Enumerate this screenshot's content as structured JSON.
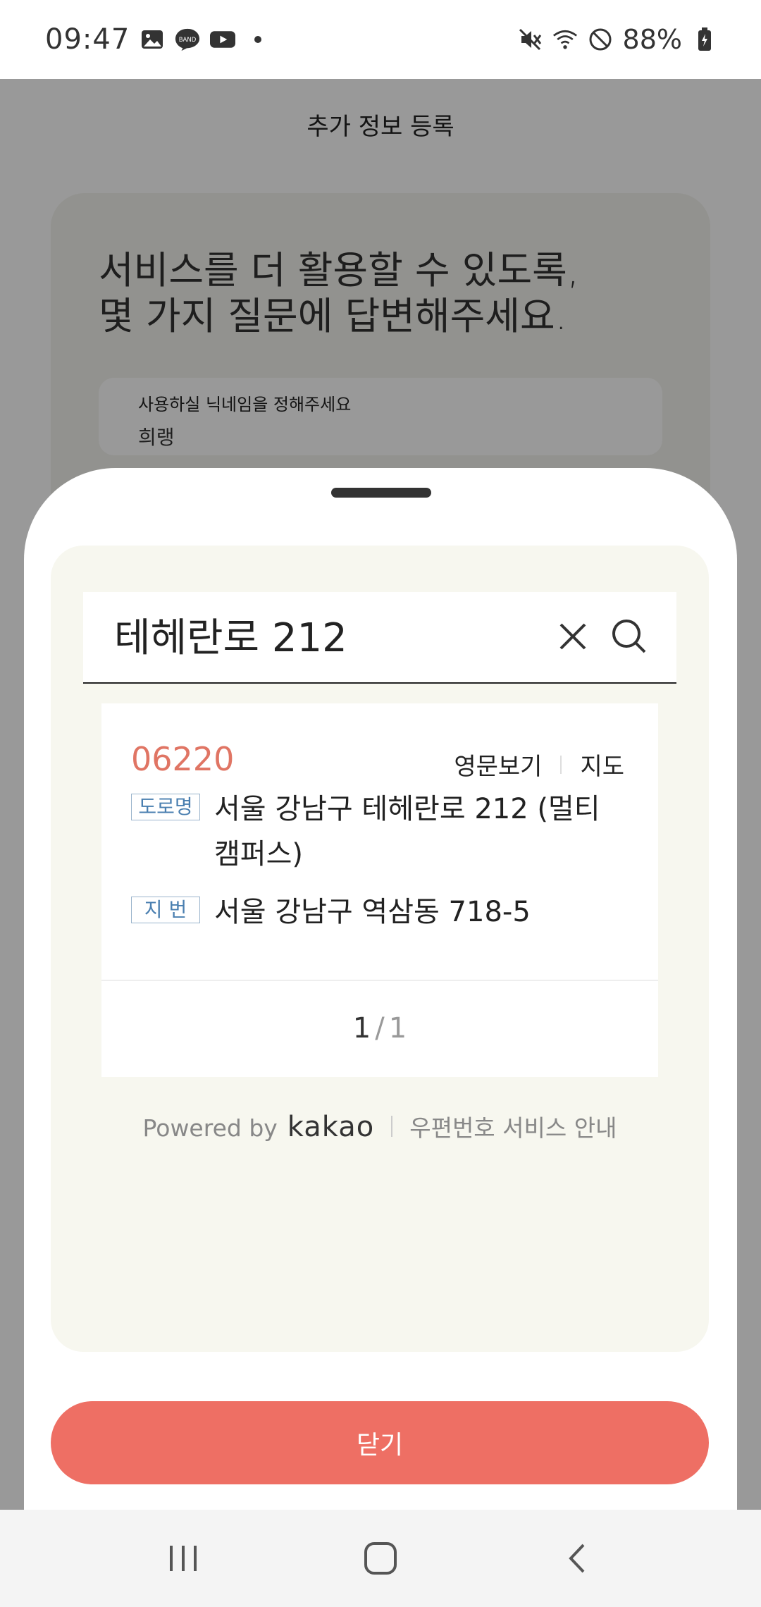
{
  "status_bar": {
    "time": "09:47",
    "battery_pct": "88%",
    "notification_icons": [
      "gallery-icon",
      "band-icon",
      "youtube-icon",
      "dot-icon"
    ],
    "system_icons": [
      "mute-icon",
      "wifi-icon",
      "dnd-icon",
      "battery-icon"
    ]
  },
  "background_page": {
    "title": "추가 정보 등록",
    "headline": "서비스를 더 활용할 수 있도록,\n몇 가지 질문에 답변해주세요.",
    "nickname_label": "사용하실 닉네임을 정해주세요",
    "nickname_value": "희랭"
  },
  "search": {
    "query": "테헤란로 212",
    "clear_icon": "close-icon",
    "search_icon": "search-icon"
  },
  "result": {
    "zipcode": "06220",
    "english_label": "영문보기",
    "map_label": "지도",
    "road_tag": "도로명",
    "road_address": "서울 강남구 테헤란로 212 (멀티캠퍼스)",
    "jibun_tag": "지 번",
    "jibun_address": "서울 강남구 역삼동 718-5"
  },
  "pagination": {
    "current": "1",
    "separator": "/",
    "total": "1"
  },
  "footer": {
    "powered_by": "Powered by",
    "brand": "kakao",
    "service_info": "우편번호 서비스 안내"
  },
  "close_button": "닫기",
  "nav_bar": [
    "recent-apps-icon",
    "home-icon",
    "back-icon"
  ],
  "colors": {
    "accent": "#ee6f64",
    "zipcode": "#e07564",
    "tag_blue": "#4a7fb0",
    "card_bg": "#f7f7ef"
  }
}
